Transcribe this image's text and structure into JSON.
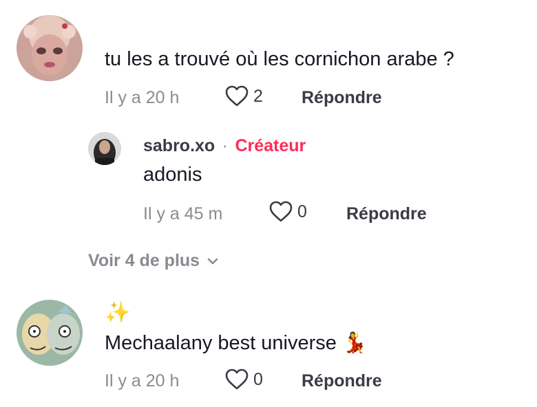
{
  "comments": [
    {
      "avatar": "avatar-pink-character",
      "body": "tu les a trouvé où les cornichon arabe ?",
      "time": "Il y a 20 h",
      "likes": "2",
      "reply_label": "Répondre",
      "replies": [
        {
          "avatar": "avatar-user-photo",
          "username": "sabro.xo",
          "separator": "·",
          "badge": "Créateur",
          "body": "adonis",
          "time": "Il y a 45 m",
          "likes": "0",
          "reply_label": "Répondre"
        }
      ],
      "view_more_label": "Voir 4 de plus"
    },
    {
      "avatar": "avatar-cartoon-characters",
      "emoji_line": "✨",
      "body": "Mechaalany best universe 💃",
      "time": "Il y a 20 h",
      "likes": "0",
      "reply_label": "Répondre"
    }
  ],
  "colors": {
    "text": "#161823",
    "muted": "#8a8b91",
    "creator_badge": "#fe2c55"
  },
  "icons": {
    "like": "heart-outline-icon",
    "expand": "chevron-down-icon"
  }
}
